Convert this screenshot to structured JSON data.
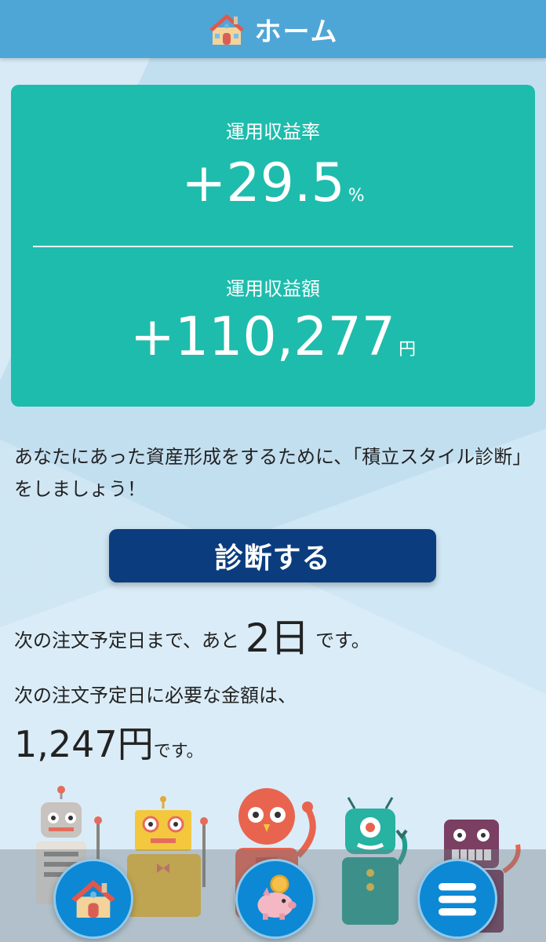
{
  "header": {
    "title": "ホーム",
    "icon": "house-icon"
  },
  "summary": {
    "rate_label": "運用収益率",
    "rate_value": "+29.5",
    "rate_unit": "%",
    "amount_label": "運用収益額",
    "amount_value": "+110,277",
    "amount_unit": "円"
  },
  "intro": {
    "text": "あなたにあった資産形成をするために、「積立スタイル診断」をしましょう！"
  },
  "diagnose_button": {
    "label": "診断する"
  },
  "schedule": {
    "days_prefix": "次の注文予定日まで、あと",
    "days_value": "2",
    "days_unit": "日",
    "days_suffix": "です。",
    "amount_label": "次の注文予定日に必要な金額は、",
    "amount_value": "1,247",
    "amount_unit": "円",
    "amount_suffix": "です。"
  },
  "bottom_nav": [
    {
      "icon": "house-icon"
    },
    {
      "icon": "piggy-bank-icon"
    },
    {
      "icon": "menu-icon"
    }
  ],
  "colors": {
    "header": "#4ea6d7",
    "card": "#1ebcac",
    "button": "#0b3d7e",
    "nav_button": "#0c88d4"
  }
}
